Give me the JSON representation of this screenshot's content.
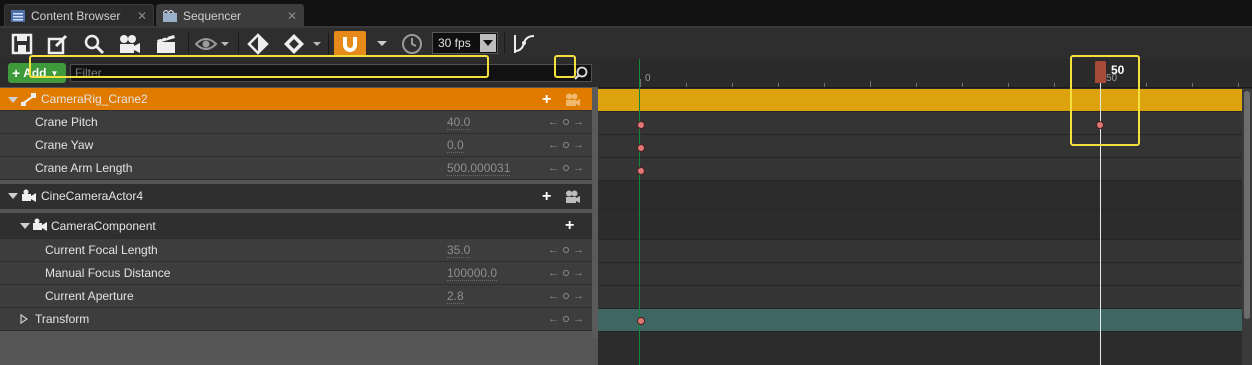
{
  "tabs": [
    {
      "label": "Content Browser",
      "close": "✕",
      "icon": "content-browser-icon"
    },
    {
      "label": "Sequencer",
      "close": "✕",
      "icon": "sequencer-icon"
    }
  ],
  "toolbar": {
    "fps": "30 fps",
    "icons": [
      "save-icon",
      "edit-icon",
      "search-icon",
      "camera-icon",
      "clapboard-icon",
      "eye-icon",
      "key-icon",
      "transform-key-icon",
      "snap-magnet-icon",
      "clock-icon",
      "curve-editor-icon"
    ]
  },
  "outliner": {
    "add_label": "Add",
    "filter_placeholder": "Filter",
    "rows": [
      {
        "label": "CameraRig_Crane2",
        "type": "actor"
      },
      {
        "label": "Crane Pitch",
        "value": "40.0"
      },
      {
        "label": "Crane Yaw",
        "value": "0.0"
      },
      {
        "label": "Crane Arm Length",
        "value": "500.000031"
      },
      {
        "label": "CineCameraActor4",
        "type": "actor"
      },
      {
        "label": "CameraComponent",
        "type": "component"
      },
      {
        "label": "Current Focal Length",
        "value": "35.0"
      },
      {
        "label": "Manual Focus Distance",
        "value": "100000.0"
      },
      {
        "label": "Current Aperture",
        "value": "2.8"
      },
      {
        "label": "Transform",
        "type": "track"
      }
    ]
  },
  "timeline": {
    "ruler_start": "0",
    "ruler_mid": "50",
    "playhead_frame": "50"
  },
  "colors": {
    "selected_row": "#e07b00",
    "section_gold": "#dca30e",
    "transform_teal": "#3e6763",
    "highlight": "#f3df3e",
    "add_green": "#3e9a3a"
  }
}
